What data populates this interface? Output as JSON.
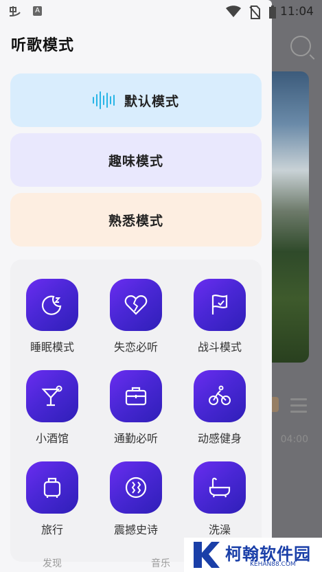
{
  "status_bar": {
    "time": "11:04",
    "left_icons": [
      "app-icon",
      "a-icon"
    ],
    "right_icons": [
      "wifi-icon",
      "no-sim-icon",
      "battery-icon"
    ]
  },
  "drawer": {
    "title": "听歌模式",
    "modes": [
      {
        "label": "默认模式",
        "icon": "waveform-icon",
        "color": "#d9edfd"
      },
      {
        "label": "趣味模式",
        "color": "#e9e8fd"
      },
      {
        "label": "熟悉模式",
        "color": "#fdeee1"
      }
    ],
    "scenes": [
      {
        "label": "睡眠模式",
        "icon": "moon-icon"
      },
      {
        "label": "失恋必听",
        "icon": "broken-heart-icon"
      },
      {
        "label": "战斗模式",
        "icon": "flag-icon"
      },
      {
        "label": "小酒馆",
        "icon": "cocktail-icon"
      },
      {
        "label": "通勤必听",
        "icon": "briefcase-icon"
      },
      {
        "label": "动感健身",
        "icon": "cyclist-icon"
      },
      {
        "label": "旅行",
        "icon": "luggage-icon"
      },
      {
        "label": "震撼史诗",
        "icon": "vibration-icon"
      },
      {
        "label": "洗澡",
        "icon": "bathtub-icon"
      }
    ],
    "bottom_tabs": [
      "发现",
      "音乐"
    ]
  },
  "background": {
    "duration": "04:00"
  },
  "watermark": {
    "title": "柯翰软件园",
    "sub": "KEHAN88.COM"
  },
  "colors": {
    "accent_gradient_start": "#6a2df0",
    "accent_gradient_end": "#2f1fb8",
    "wave": "#27b5e6"
  }
}
